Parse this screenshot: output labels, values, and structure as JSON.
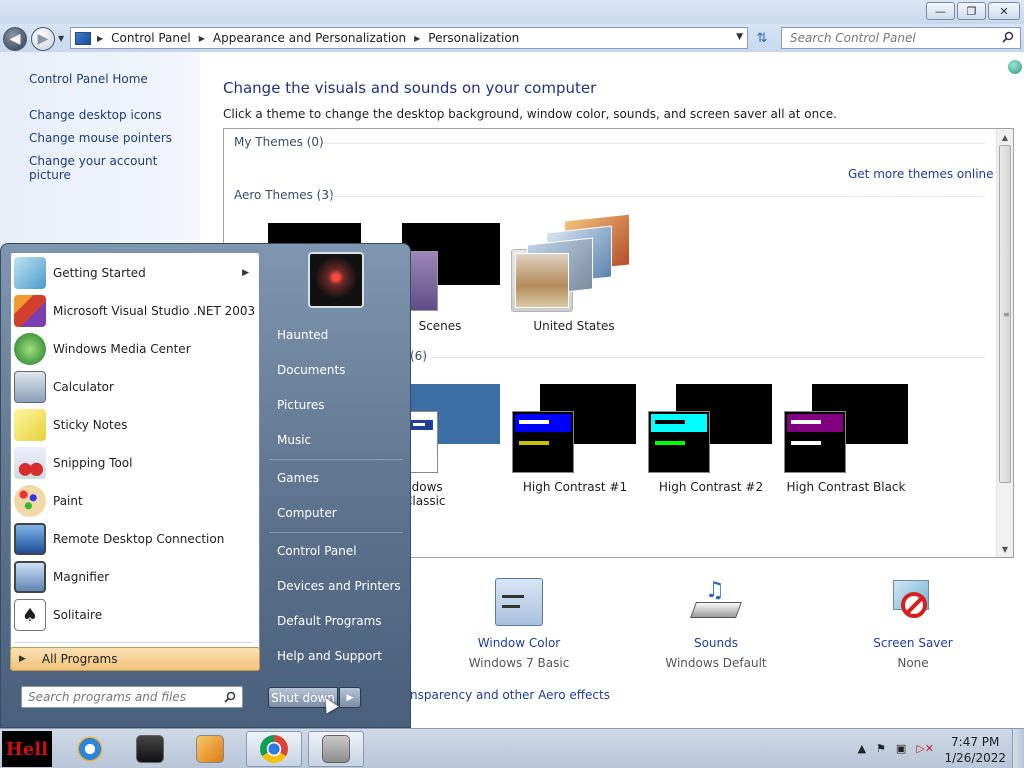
{
  "window": {
    "minimize_label": "—",
    "maximize_label": "❐",
    "close_label": "✕"
  },
  "address": {
    "crumbs": [
      "Control Panel",
      "Appearance and Personalization",
      "Personalization"
    ],
    "search_placeholder": "Search Control Panel"
  },
  "left_pane": {
    "links": [
      "Control Panel Home",
      "Change desktop icons",
      "Change mouse pointers",
      "Change your account picture"
    ]
  },
  "main": {
    "title": "Change the visuals and sounds on your computer",
    "subtitle": "Click a theme to change the desktop background, window color, sounds, and screen saver all at once.",
    "my_themes": "My Themes (0)",
    "aero_themes": "Aero Themes (3)",
    "get_more": "Get more themes online",
    "basic_count": "(6)",
    "aero_items": [
      "Scenes",
      "United States"
    ],
    "basic_items": [
      "ndows Classic",
      "High Contrast #1",
      "High Contrast #2",
      "High Contrast Black"
    ],
    "settings": [
      {
        "title": "Window Color",
        "sub": "Windows 7 Basic"
      },
      {
        "title": "Sounds",
        "sub": "Windows Default"
      },
      {
        "title": "Screen Saver",
        "sub": "None"
      }
    ],
    "aero_link": "nsparency and other Aero effects"
  },
  "start_menu": {
    "programs": [
      {
        "label": "Getting Started",
        "icon": "getting-started-icon",
        "has_arrow": true
      },
      {
        "label": "Microsoft Visual Studio .NET 2003",
        "icon": "visual-studio-icon"
      },
      {
        "label": "Windows Media Center",
        "icon": "media-center-icon"
      },
      {
        "label": "Calculator",
        "icon": "calculator-icon"
      },
      {
        "label": "Sticky Notes",
        "icon": "sticky-notes-icon"
      },
      {
        "label": "Snipping Tool",
        "icon": "snipping-tool-icon"
      },
      {
        "label": "Paint",
        "icon": "paint-icon"
      },
      {
        "label": "Remote Desktop Connection",
        "icon": "remote-desktop-icon"
      },
      {
        "label": "Magnifier",
        "icon": "magnifier-icon"
      },
      {
        "label": "Solitaire",
        "icon": "solitaire-icon"
      }
    ],
    "all_programs": "All Programs",
    "search_placeholder": "Search programs and files",
    "right_items": [
      "Haunted",
      "Documents",
      "Pictures",
      "Music",
      "Games",
      "Computer",
      "Control Panel",
      "Devices and Printers",
      "Default Programs",
      "Help and Support"
    ],
    "shutdown_label": "Shut down"
  },
  "taskbar": {
    "start_label": "Hell",
    "time": "7:47 PM",
    "date": "1/26/2022"
  }
}
